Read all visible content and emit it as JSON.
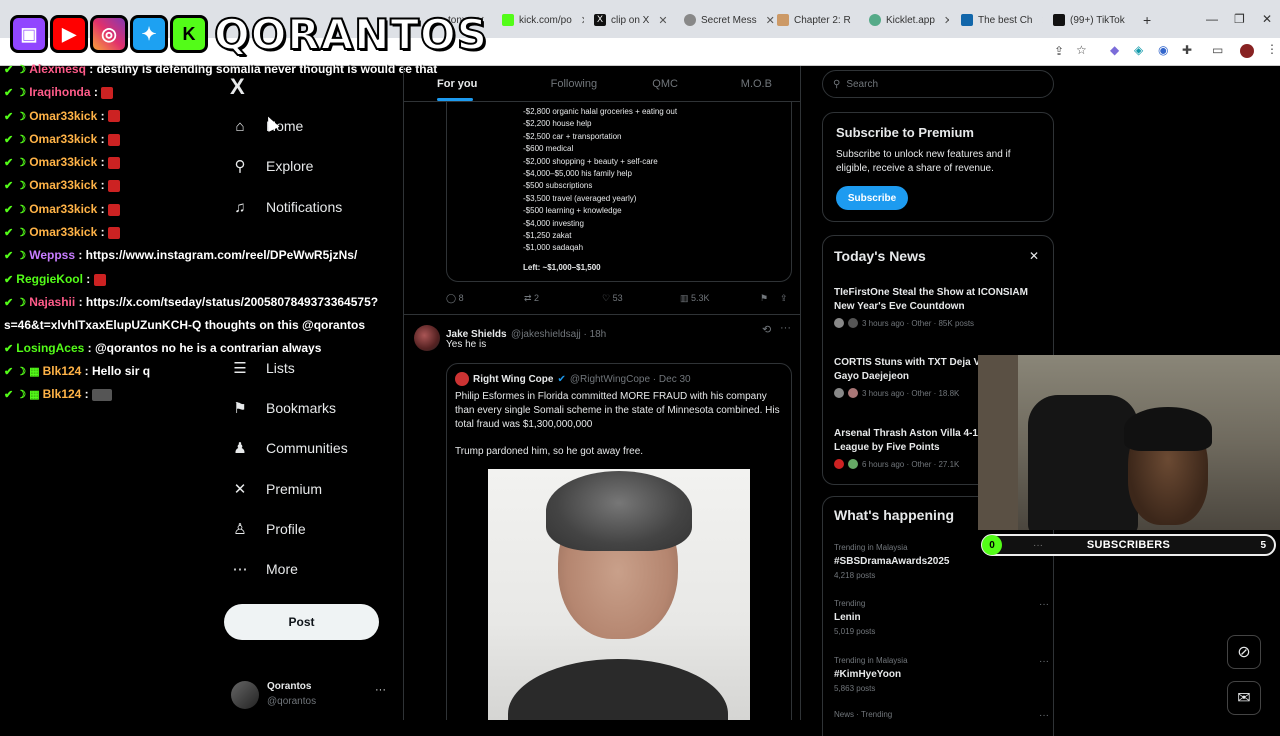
{
  "browser": {
    "tabs": [
      {
        "label": "tonx",
        "color": "#7a3"
      },
      {
        "label": "kick.com/po",
        "color": "#53fc18"
      },
      {
        "label": "clip on X",
        "color": "#111"
      },
      {
        "label": "Secret Mess",
        "color": "#888"
      },
      {
        "label": "Chapter 2: R",
        "color": "#c96"
      },
      {
        "label": "Kicklet.app",
        "color": "#5a8"
      },
      {
        "label": "The best Ch",
        "color": "#16a"
      },
      {
        "label": "(99+) TikTok",
        "color": "#111"
      }
    ],
    "new_tab": "+"
  },
  "overlay": {
    "brand": "QORANTOS",
    "socials": [
      "twitch-icon",
      "youtube-icon",
      "instagram-icon",
      "twitter-icon",
      "kick-icon"
    ]
  },
  "chat": [
    {
      "user": "Alexmesq",
      "color": "#ff5c8a",
      "msg": "destiny is defending somalia never thought is would ee that",
      "emote": false
    },
    {
      "user": "Iraqihonda",
      "color": "#ff5c8a",
      "msg": "",
      "emote": true
    },
    {
      "user": "Omar33kick",
      "color": "#ffb347",
      "msg": "",
      "emote": true
    },
    {
      "user": "Omar33kick",
      "color": "#ffb347",
      "msg": "",
      "emote": true
    },
    {
      "user": "Omar33kick",
      "color": "#ffb347",
      "msg": "",
      "emote": true
    },
    {
      "user": "Omar33kick",
      "color": "#ffb347",
      "msg": "",
      "emote": true
    },
    {
      "user": "Omar33kick",
      "color": "#ffb347",
      "msg": "",
      "emote": true
    },
    {
      "user": "Omar33kick",
      "color": "#ffb347",
      "msg": "",
      "emote": true
    },
    {
      "user": "Weppss",
      "color": "#c77dff",
      "msg": "https://www.instagram.com/reel/DPeWwR5jzNs/",
      "emote": false
    },
    {
      "user": "ReggieKool",
      "color": "#53fc18",
      "msg": "",
      "emote": true
    },
    {
      "user": "Najashii",
      "color": "#ff5c8a",
      "msg": "https://x.com/tseday/status/2005807849373364575?",
      "emote": false
    },
    {
      "user": "",
      "color": "#fff",
      "msg": "s=46&t=xlvhITxaxElupUZunKCH-Q thoughts on this @qorantos",
      "emote": false
    },
    {
      "user": "LosingAces",
      "color": "#53fc18",
      "msg": "@qorantos no he is a contrarian always",
      "emote": false
    },
    {
      "user": "Blk124",
      "color": "#ffb347",
      "msg": "Hello sir q",
      "emote": false
    },
    {
      "user": "Blk124",
      "color": "#ffb347",
      "msg": "",
      "emote": true
    }
  ],
  "nav": {
    "logo": "X",
    "items": [
      {
        "label": "Home",
        "icon": "home-icon",
        "glyph": "⌂"
      },
      {
        "label": "Explore",
        "icon": "search-icon",
        "glyph": "⚲"
      },
      {
        "label": "Notifications",
        "icon": "bell-icon",
        "glyph": "♫"
      },
      {
        "label": "Lists",
        "icon": "list-icon",
        "glyph": "☰"
      },
      {
        "label": "Bookmarks",
        "icon": "bookmark-icon",
        "glyph": "⚑"
      },
      {
        "label": "Communities",
        "icon": "people-icon",
        "glyph": "♟"
      },
      {
        "label": "Premium",
        "icon": "x-icon",
        "glyph": "✕"
      },
      {
        "label": "Profile",
        "icon": "person-icon",
        "glyph": "♙"
      },
      {
        "label": "More",
        "icon": "more-icon",
        "glyph": "⋯"
      }
    ],
    "post_label": "Post",
    "profile": {
      "name": "Qorantos",
      "handle": "@qorantos",
      "more": "···"
    }
  },
  "feed": {
    "tabs": [
      "For you",
      "Following",
      "QMC",
      "M.O.B"
    ],
    "budget_lines": [
      "-$2,800 organic halal groceries + eating out",
      "-$2,200 house help",
      "-$2,500 car + transportation",
      "-$600 medical",
      "-$2,000 shopping + beauty + self-care",
      "-$4,000–$5,000 his family help",
      "-$500 subscriptions",
      "-$3,500 travel (averaged yearly)",
      "-$500 learning + knowledge",
      "-$4,000 investing",
      "-$1,250 zakat",
      "-$1,000 sadaqah"
    ],
    "budget_left": "Left: ~$1,000–$1,500",
    "tweet1_actions": {
      "replies": "8",
      "reposts": "2",
      "likes": "53",
      "views": "5.3K"
    },
    "tweet2": {
      "name": "Jake Shields",
      "handle": "@jakeshieldsajj · 18h",
      "text": "Yes he is",
      "quote": {
        "name": "Right Wing Cope",
        "handle": "@RightWingCope · Dec 30",
        "text": "Philip Esformes in Florida committed MORE FRAUD with his company than every single Somali scheme in the state of Minnesota combined. His total fraud was $1,300,000,000\n\nTrump pardoned him, so he got away free."
      }
    }
  },
  "right": {
    "search_placeholder": "Search",
    "premium": {
      "title": "Subscribe to Premium",
      "desc": "Subscribe to unlock new features and if eligible, receive a share of revenue.",
      "button": "Subscribe"
    },
    "news": {
      "title": "Today's News",
      "close": "✕",
      "items": [
        {
          "title": "TIeFirstOne Steal the Show at ICONSIAM New Year's Eve Countdown",
          "meta": "3 hours ago · Other · 85K posts"
        },
        {
          "title": "CORTIS Stuns with TXT Deja Vu 2025 MBC Gayo Daejejeon",
          "meta": "3 hours ago · Other · 18.8K"
        },
        {
          "title": "Arsenal Thrash Aston Villa 4-1 to Lead League by Five Points",
          "meta": "6 hours ago · Other · 27.1K"
        }
      ]
    },
    "happening": {
      "title": "What's happening",
      "trends": [
        {
          "ctx": "Trending in Malaysia",
          "name": "#SBSDramaAwards2025",
          "count": "4,218 posts"
        },
        {
          "ctx": "Trending",
          "name": "Lenin",
          "count": "5,019 posts"
        },
        {
          "ctx": "Trending in Malaysia",
          "name": "#KimHyeYoon",
          "count": "5,863 posts"
        },
        {
          "ctx": "News · Trending",
          "name": "",
          "count": ""
        }
      ]
    }
  },
  "stream": {
    "sub_label": "SUBSCRIBERS",
    "sub_current": "0",
    "sub_goal": "5"
  }
}
